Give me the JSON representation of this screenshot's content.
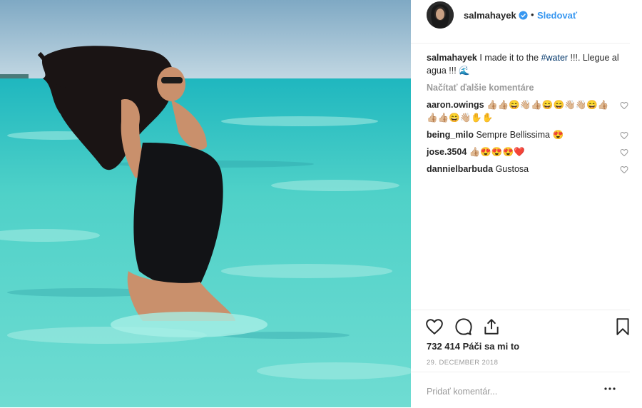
{
  "post": {
    "username": "salmahayek",
    "follow_label": "Sledovať",
    "dot": "•",
    "caption": {
      "username": "salmahayek",
      "text_before": "I made it to the ",
      "hashtag": "#water",
      "text_after": " !!!. Llegue al agua !!! ",
      "emoji": "🌊"
    },
    "load_more": "Načítať ďalšie komentáre",
    "comments": [
      {
        "user": "aaron.owings",
        "text": "👍🏼👍🏼😄👋🏼👍🏼😄😄👋🏼👋🏼😄👍🏼👍🏼👍🏼😄👋🏼✋✋"
      },
      {
        "user": "being_milo",
        "text": "Sempre Bellissima 😍"
      },
      {
        "user": "jose.3504",
        "text": "👍🏼😍😍😍❤️"
      },
      {
        "user": "dannielbarbuda",
        "text": "Gustosa"
      }
    ],
    "likes": "732 414 Páči sa mi to",
    "date": "29. DECEMBER 2018",
    "comment_placeholder": "Pridať komentár..."
  },
  "icons": {
    "verified": "verified-badge-icon",
    "like": "heart-icon",
    "comment": "comment-bubble-icon",
    "share": "share-icon",
    "save": "bookmark-icon",
    "more": "more-options-icon"
  },
  "colors": {
    "link": "#3897f0",
    "hashtag": "#003569",
    "muted": "#999999",
    "sky": "#8fb8d0",
    "sea": "#3fc6c0"
  }
}
